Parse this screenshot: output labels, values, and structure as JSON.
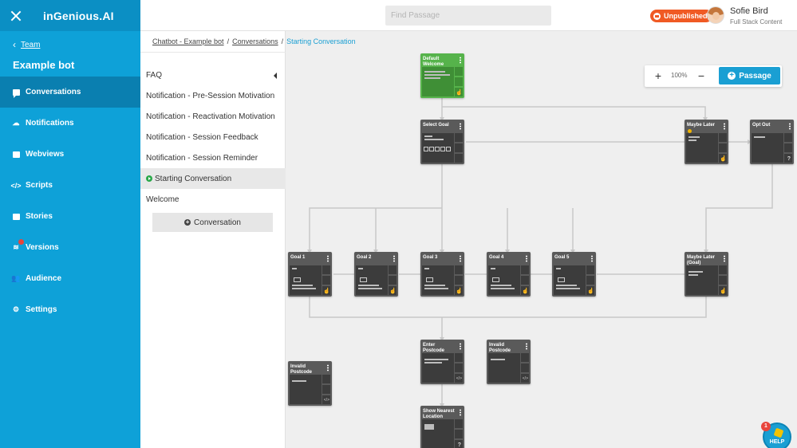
{
  "app": {
    "logo": "inGenious.AI"
  },
  "sidebar": {
    "back_label": "Team",
    "bot_name": "Example bot",
    "items": [
      {
        "label": "Conversations",
        "icon": "chat-icon",
        "active": true
      },
      {
        "label": "Notifications",
        "icon": "cloud-icon"
      },
      {
        "label": "Webviews",
        "icon": "window-icon"
      },
      {
        "label": "Scripts",
        "icon": "code-icon"
      },
      {
        "label": "Stories",
        "icon": "stories-icon"
      },
      {
        "label": "Versions",
        "icon": "layers-icon"
      },
      {
        "label": "Audience",
        "icon": "people-icon"
      },
      {
        "label": "Settings",
        "icon": "gear-icon"
      }
    ]
  },
  "topbar": {
    "search_placeholder": "Find Passage",
    "status_label": "Unpublished",
    "user_name": "Sofie Bird",
    "user_role": "Full Stack Content"
  },
  "breadcrumb": {
    "items": [
      "Chatbot - Example bot",
      "Conversations",
      "Starting Conversation"
    ]
  },
  "conversations": {
    "items": [
      "FAQ",
      "Notification - Pre-Session Motivation",
      "Notification - Reactivation Motivation",
      "Notification - Session Feedback",
      "Notification - Session Reminder",
      "Starting Conversation",
      "Welcome"
    ],
    "active": "Starting Conversation",
    "add_label": "Conversation"
  },
  "toolbar": {
    "zoom": "100%",
    "zoom_in": "+",
    "zoom_out": "−",
    "passage_label": "Passage"
  },
  "nodes": [
    {
      "title": "Default Welcome",
      "color": "#56b34b"
    },
    {
      "title": "Select Goal"
    },
    {
      "title": "Maybe Later"
    },
    {
      "title": "Opt Out"
    },
    {
      "title": "Goal 1"
    },
    {
      "title": "Goal 2"
    },
    {
      "title": "Goal 3"
    },
    {
      "title": "Goal 4"
    },
    {
      "title": "Goal 5"
    },
    {
      "title": "Maybe Later (Goal)"
    },
    {
      "title": "Enter Postcode"
    },
    {
      "title": "Invalid Postcode"
    },
    {
      "title": "Invalid Postcode"
    },
    {
      "title": "Show Nearest Location"
    }
  ],
  "help": {
    "label": "HELP",
    "badge": "1"
  },
  "colors": {
    "sidebar": "#0ea1d8",
    "accent": "#1a9fd3",
    "status": "#f05a24",
    "start_node": "#56b34b",
    "node": "#5a5a5a"
  }
}
